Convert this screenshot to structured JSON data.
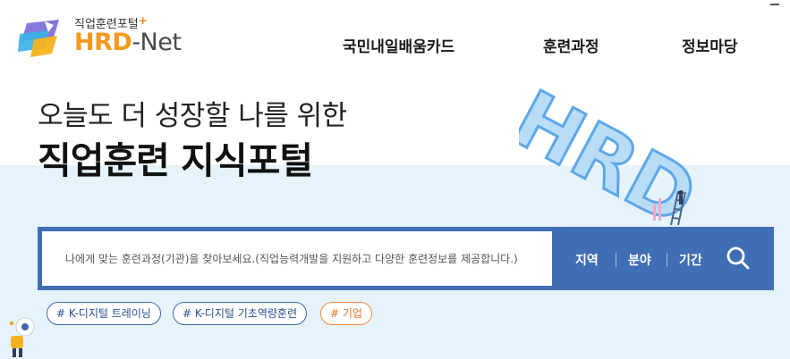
{
  "header": {
    "logo_subtitle": "직업훈련포털",
    "logo_plus": "+",
    "logo_brand_hrd": "HRD",
    "logo_brand_net": "-Net"
  },
  "nav": {
    "items": [
      {
        "label": "국민내일배움카드"
      },
      {
        "label": "훈련과정"
      },
      {
        "label": "정보마당"
      }
    ]
  },
  "hero": {
    "line1": "오늘도 더 성장할 나를 위한",
    "line2": "직업훈련 지식포털",
    "art_text": "HRD"
  },
  "search": {
    "placeholder": "나에게 맞는 훈련과정(기관)을 찾아보세요.(직업능력개발을 지원하고 다양한 훈련정보를 제공합니다.)",
    "value": "",
    "filters": [
      {
        "label": "지역"
      },
      {
        "label": "분야"
      },
      {
        "label": "기간"
      }
    ],
    "button_icon": "search-icon"
  },
  "tags": [
    {
      "label": "# K-디지털 트레이닝",
      "color": "#3d67b1"
    },
    {
      "label": "# K-디지털 기초역량훈련",
      "color": "#3d67b1"
    },
    {
      "label": "# 기업",
      "color": "#ee8a3d"
    }
  ],
  "colors": {
    "brand_orange": "#f39a1e",
    "search_bar": "#3f6eb5",
    "hero_band": "#e6f3fb"
  }
}
